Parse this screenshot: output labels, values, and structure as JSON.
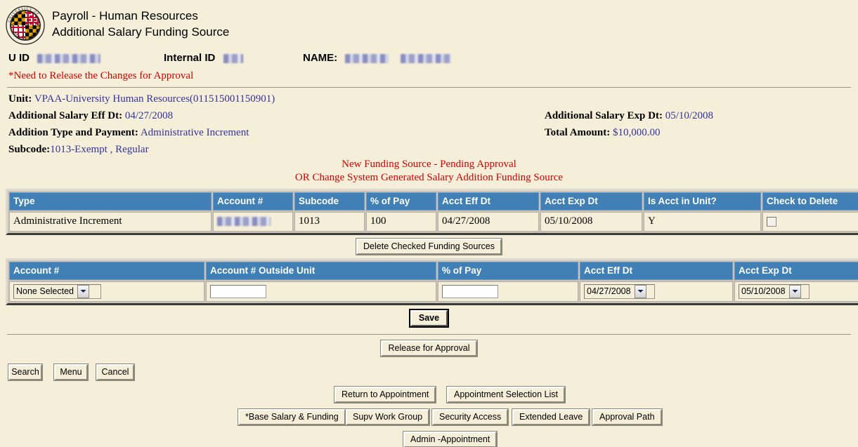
{
  "header": {
    "logo_alt": "University of Maryland seal",
    "title_line1": "Payroll - Human Resources",
    "title_line2": "Additional Salary Funding Source"
  },
  "identity": {
    "uid_label": "U ID",
    "uid_value": "",
    "internal_id_label": "Internal ID",
    "internal_id_value": "",
    "name_label": "NAME:",
    "name_value": "",
    "warning": "*Need to Release the Changes for Approval"
  },
  "info": {
    "unit_label": "Unit:",
    "unit_value": "VPAA-University Human Resources(011515001150901)",
    "eff_dt_label": "Additional Salary Eff Dt:",
    "eff_dt_value": "04/27/2008",
    "addition_type_label": "Addition Type and Payment:",
    "addition_type_value": "Administrative Increment",
    "subcode_label": "Subcode:",
    "subcode_value": "1013-Exempt , Regular",
    "exp_dt_label": "Additional Salary Exp Dt:",
    "exp_dt_value": "05/10/2008",
    "total_amount_label": "Total Amount:",
    "total_amount_value": "$10,000.00"
  },
  "notice": {
    "line1": "New Funding Source - Pending Approval",
    "line2": "OR Change System Generated Salary Addition Funding Source"
  },
  "existing_table": {
    "columns": [
      "Type",
      "Account #",
      "Subcode",
      "% of Pay",
      "Acct Eff Dt",
      "Acct Exp Dt",
      "Is Acct in Unit?",
      "Check to Delete"
    ],
    "rows": [
      {
        "type": "Administrative Increment",
        "account": "",
        "subcode": "1013",
        "pct_of_pay": "100",
        "acct_eff_dt": "04/27/2008",
        "acct_exp_dt": "05/10/2008",
        "is_acct_in_unit": "Y",
        "check_to_delete": false
      }
    ],
    "delete_button": "Delete Checked Funding Sources"
  },
  "new_table": {
    "columns": [
      "Account #",
      "Account # Outside Unit",
      "% of Pay",
      "Acct Eff Dt",
      "Acct Exp Dt"
    ],
    "account_select_value": "None Selected",
    "account_outside_unit_value": "",
    "pct_of_pay_value": "",
    "acct_eff_dt_value": "04/27/2008",
    "acct_exp_dt_value": "05/10/2008"
  },
  "actions": {
    "save": "Save",
    "release": "Release for Approval",
    "search": "Search",
    "menu": "Menu",
    "cancel": "Cancel",
    "return_to_appointment": "Return to Appointment",
    "appointment_selection_list": "Appointment Selection List",
    "base_salary_funding": "*Base Salary & Funding",
    "supv_work_group": "Supv Work Group",
    "security_access": "Security Access",
    "extended_leave": "Extended Leave",
    "approval_path": "Approval Path",
    "admin_appointment": "Admin -Appointment"
  },
  "colors": {
    "page_background": "#f5eed9",
    "table_header_blue": "#4180b6",
    "link_value_blue": "#333399",
    "warning_red": "#d00000"
  }
}
